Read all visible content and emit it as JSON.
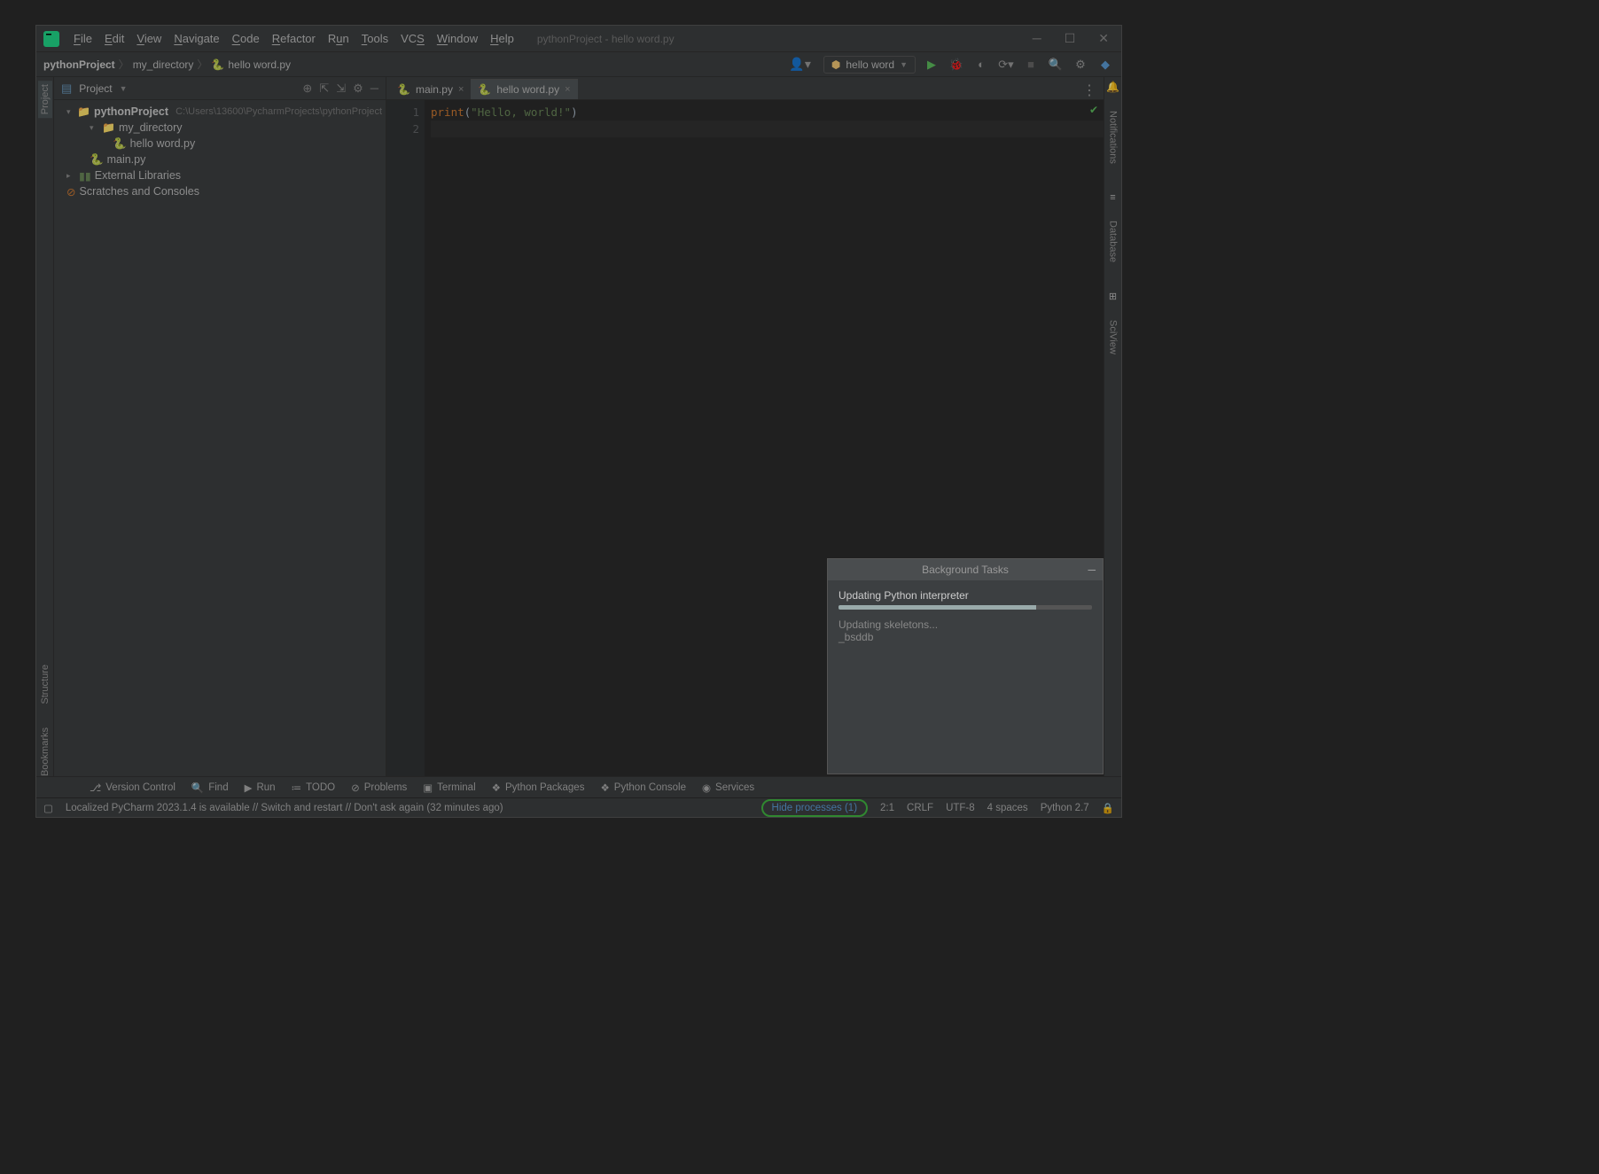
{
  "title_path": "pythonProject - hello word.py",
  "menu": [
    "File",
    "Edit",
    "View",
    "Navigate",
    "Code",
    "Refactor",
    "Run",
    "Tools",
    "VCS",
    "Window",
    "Help"
  ],
  "breadcrumb": {
    "root": "pythonProject",
    "dir": "my_directory",
    "file": "hello word.py"
  },
  "run_config": "hello word",
  "sidebar": {
    "title": "Project",
    "project_name": "pythonProject",
    "project_path": "C:\\Users\\13600\\PycharmProjects\\pythonProject",
    "my_dir": "my_directory",
    "file_hello": "hello word.py",
    "file_main": "main.py",
    "ext_libs": "External Libraries",
    "scratches": "Scratches and Consoles"
  },
  "tabs": {
    "t1": "main.py",
    "t2": "hello word.py"
  },
  "code": {
    "line1_kw": "print",
    "line1_paren_open": "(",
    "line1_str": "\"Hello, world!\"",
    "line1_paren_close": ")"
  },
  "line_numbers": [
    "1",
    "2"
  ],
  "bottom_tools": {
    "vc": "Version Control",
    "find": "Find",
    "run": "Run",
    "todo": "TODO",
    "problems": "Problems",
    "terminal": "Terminal",
    "pkg": "Python Packages",
    "console": "Python Console",
    "services": "Services"
  },
  "status": {
    "msg": "Localized PyCharm 2023.1.4 is available // Switch and restart // Don't ask again (32 minutes ago)",
    "hide_proc": "Hide processes (1)",
    "pos": "2:1",
    "sep": "CRLF",
    "enc": "UTF-8",
    "indent": "4 spaces",
    "interp": "Python 2.7"
  },
  "bg_panel": {
    "title": "Background Tasks",
    "task": "Updating Python interpreter",
    "sub1": "Updating skeletons...",
    "sub2": "_bsddb"
  },
  "right_gutter": {
    "notif": "Notifications",
    "db": "Database",
    "sci": "SciView"
  },
  "left_gutter": {
    "project": "Project",
    "structure": "Structure",
    "bookmarks": "Bookmarks"
  }
}
